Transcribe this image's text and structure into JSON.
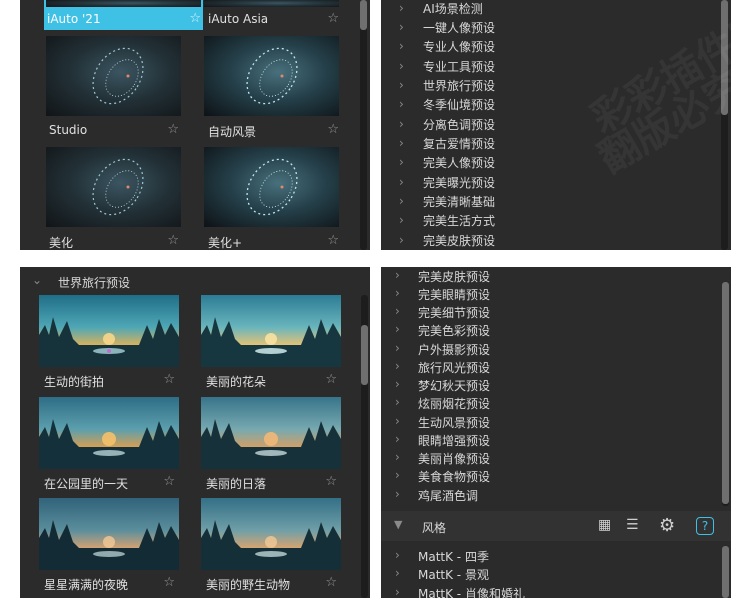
{
  "top_left": {
    "presets": [
      {
        "label": "iAuto '21",
        "selected": true
      },
      {
        "label": "iAuto Asia",
        "selected": false
      },
      {
        "label": "Studio",
        "selected": false
      },
      {
        "label": "自动风景",
        "selected": false
      },
      {
        "label": "美化",
        "selected": false
      },
      {
        "label": "美化+",
        "selected": false
      }
    ],
    "star_icon": "star-icon"
  },
  "top_right": {
    "items": [
      "AI场景检测",
      "一键人像预设",
      "专业人像预设",
      "专业工具预设",
      "世界旅行预设",
      "冬季仙境预设",
      "分离色调预设",
      "复古爱情预设",
      "完美人像预设",
      "完美曝光预设",
      "完美清晰基础",
      "完美生活方式",
      "完美皮肤预设"
    ]
  },
  "bottom_left": {
    "group_title": "世界旅行预设",
    "presets": [
      {
        "label": "生动的街拍"
      },
      {
        "label": "美丽的花朵"
      },
      {
        "label": "在公园里的一天"
      },
      {
        "label": "美丽的日落"
      },
      {
        "label": "星星满满的夜晚"
      },
      {
        "label": "美丽的野生动物"
      }
    ]
  },
  "bottom_right": {
    "items": [
      "完美皮肤预设",
      "完美眼睛预设",
      "完美细节预设",
      "完美色彩预设",
      "户外摄影预设",
      "旅行风光预设",
      "梦幻秋天预设",
      "炫丽烟花预设",
      "生动风景预设",
      "眼睛增强预设",
      "美丽肖像预设",
      "美食食物预设",
      "鸡尾酒色调"
    ],
    "style_header": {
      "label": "风格",
      "icons": [
        "grid-view-icon",
        "list-view-icon",
        "gear-icon",
        "help-icon"
      ],
      "help_glyph": "?"
    },
    "style_items": [
      "MattK - 四季",
      "MattK - 景观",
      "MattK - 肖像和婚礼"
    ]
  },
  "colors": {
    "accent": "#3fc1e6",
    "panel": "#2b2b2b",
    "header": "#323232"
  },
  "watermark": {
    "line1": "彩彩插件网",
    "line2": "翻版必究"
  }
}
